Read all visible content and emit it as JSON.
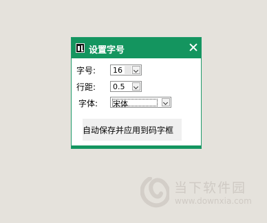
{
  "dialog": {
    "title": "设置字号",
    "icon": "app-icon",
    "close_icon": "close-icon"
  },
  "fields": {
    "size_label": "字号:",
    "size_value": "16",
    "spacing_label": "行距:",
    "spacing_value": "0.5",
    "font_label": "字体:",
    "font_value": "宋体"
  },
  "auto_apply_text": "自动保存并应用到码字框",
  "watermark": {
    "brand": "当下软件园",
    "url": "www.downxia.com"
  },
  "colors": {
    "accent": "#14955f",
    "background": "#e5e2dc"
  }
}
